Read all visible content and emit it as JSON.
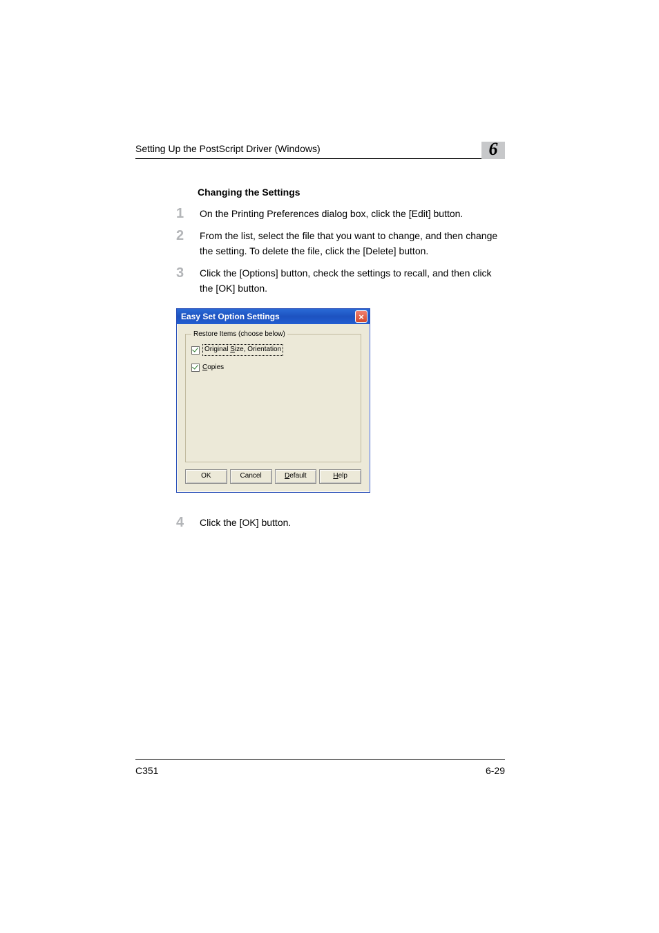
{
  "header": {
    "running_head": "Setting Up the PostScript Driver (Windows)",
    "chapter_number": "6"
  },
  "section": {
    "subheading": "Changing the Settings",
    "steps": [
      {
        "n": "1",
        "text": "On the Printing Preferences dialog box, click the [Edit] button."
      },
      {
        "n": "2",
        "text": "From the list, select the file that you want to change, and then change the setting. To delete the file, click the [Delete] button."
      },
      {
        "n": "3",
        "text": "Click the [Options] button, check the settings to recall, and then click the [OK] button."
      },
      {
        "n": "4",
        "text": "Click the [OK] button."
      }
    ]
  },
  "dialog": {
    "title": "Easy Set Option Settings",
    "group_legend": "Restore Items (choose below)",
    "checkbox1_pre": "Original ",
    "checkbox1_underline": "S",
    "checkbox1_post": "ize, Orientation",
    "checkbox2_underline": "C",
    "checkbox2_post": "opies",
    "buttons": {
      "ok": "OK",
      "cancel": "Cancel",
      "default_u": "D",
      "default_rest": "efault",
      "help_u": "H",
      "help_rest": "elp"
    }
  },
  "footer": {
    "left": "C351",
    "right": "6-29"
  }
}
